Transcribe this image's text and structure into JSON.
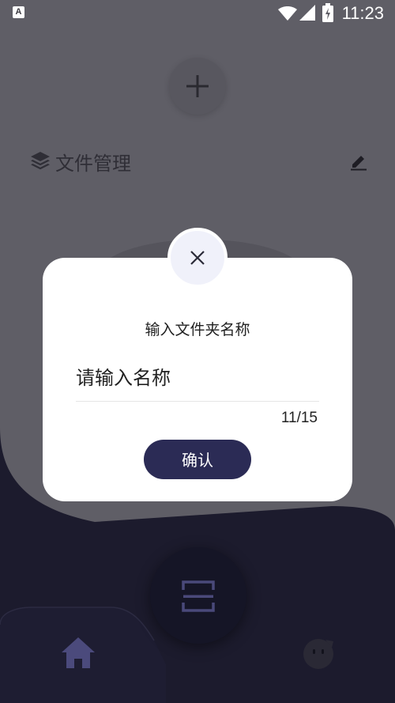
{
  "status_bar": {
    "badge": "A",
    "time": "11:23"
  },
  "main": {
    "add_icon": "plus-icon",
    "section_icon": "layers-icon",
    "section_title": "文件管理",
    "edit_icon": "pencil-icon"
  },
  "dialog": {
    "close_icon": "close-icon",
    "title": "输入文件夹名称",
    "input_value": "请输入名称",
    "counter": "11/15",
    "confirm_label": "确认"
  },
  "nav": {
    "home_icon": "home-icon",
    "scan_icon": "scan-icon",
    "profile_icon": "smile-face-icon"
  },
  "colors": {
    "overlay_bg": "#5f5e66",
    "dark_bg": "#1c1b2d",
    "accent": "#2b2b55"
  }
}
